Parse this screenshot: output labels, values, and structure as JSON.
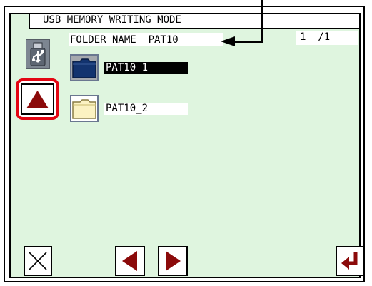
{
  "screen": {
    "title": "USB MEMORY WRITING MODE",
    "folder_name_label": "FOLDER NAME",
    "folder_name_value": "PAT10",
    "page_current": "1",
    "page_separator": "/",
    "page_total": "1"
  },
  "folders": [
    {
      "label": "PAT10_1",
      "selected": true
    },
    {
      "label": "PAT10_2",
      "selected": false
    }
  ],
  "icons": {
    "usb": "usb-memory-icon",
    "up": "up-arrow-icon",
    "cancel": "close-icon",
    "back": "left-arrow-icon",
    "forward": "right-arrow-icon",
    "enter": "enter-icon"
  },
  "colors": {
    "panel_bg": "#dff5df",
    "arrow_red": "#8b0a0a",
    "highlight": "#e30613",
    "folder_selected": "#13336f",
    "folder_normal": "#fbf2c2"
  }
}
